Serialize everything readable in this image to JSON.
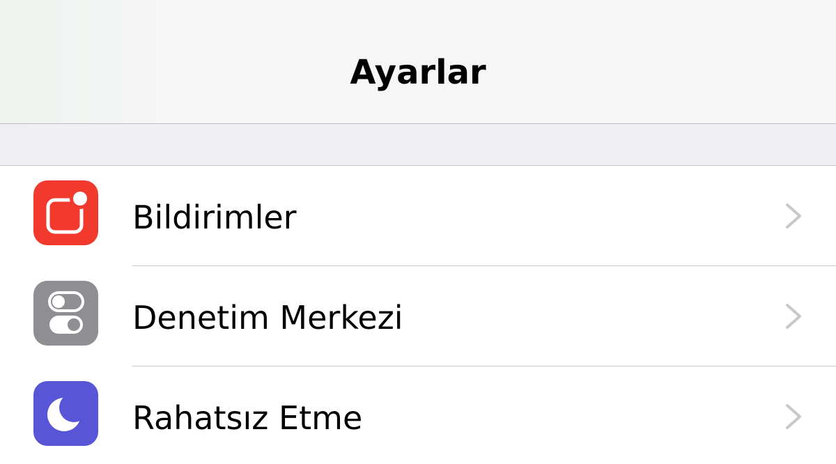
{
  "navbar": {
    "title": "Ayarlar"
  },
  "settings": {
    "items": [
      {
        "label": "Bildirimler",
        "icon": "notifications-icon",
        "color": "#f2392d"
      },
      {
        "label": "Denetim Merkezi",
        "icon": "control-center-icon",
        "color": "#8e8e93"
      },
      {
        "label": "Rahatsız Etme",
        "icon": "moon-icon",
        "color": "#5856d6"
      }
    ]
  },
  "colors": {
    "separator": "#c8c7cc",
    "group_background": "#efeff4",
    "chevron": "#c7c7cc"
  }
}
